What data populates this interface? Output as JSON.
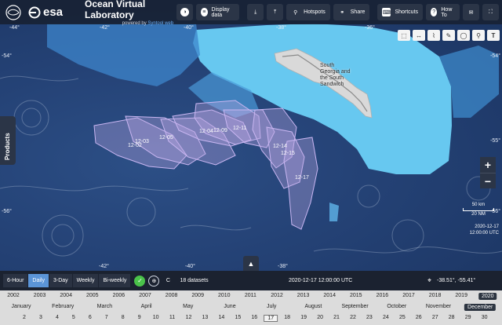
{
  "header": {
    "brand": "esa",
    "title": "Ocean Virtual Laboratory",
    "powered_prefix": "powered by",
    "powered_brand": "Syntool web",
    "buttons": [
      {
        "label": "",
        "icon": "palette-icon"
      },
      {
        "label": "Display data",
        "icon": "layers-icon"
      },
      {
        "label": "",
        "icon": "download-icon"
      },
      {
        "label": "",
        "icon": "upload-icon"
      },
      {
        "label": "Hotspots",
        "icon": "map-pin-icon"
      },
      {
        "label": "Share",
        "icon": "link-icon"
      },
      {
        "label": "Shortcuts",
        "icon": "keyboard-icon"
      },
      {
        "label": "How To",
        "icon": "help-icon"
      },
      {
        "label": "",
        "icon": "mail-icon"
      },
      {
        "label": "",
        "icon": "fullscreen-icon"
      }
    ]
  },
  "map": {
    "lat_labels": [
      "-54°",
      "-55°",
      "-56°"
    ],
    "lon_labels_top": [
      "-44°",
      "-42°",
      "-40°",
      "-38°",
      "-36°"
    ],
    "lon_labels_bottom": [
      "-42°",
      "-40°",
      "-38°"
    ],
    "island_label_lines": [
      "South",
      "Georgia and",
      "the South",
      "Sandwich"
    ],
    "track_labels": [
      "12-02",
      "12-03",
      "12-05",
      "12-04",
      "12-09",
      "12-11",
      "12-14",
      "12-15",
      "12-17"
    ],
    "scale_top": "50 km",
    "scale_bottom": "20 NM",
    "map_time_date": "2020-12-17",
    "map_time_clock": "12:00:00 UTC",
    "products_label": "Products",
    "zoom_in": "+",
    "zoom_out": "−",
    "expand_glyph": "▲",
    "toolbar_icons": [
      "rectangle-select-icon",
      "arrow-icon",
      "polyline-icon",
      "draw-icon",
      "circle-icon",
      "pin-icon",
      "text-icon"
    ]
  },
  "controls": {
    "steps": [
      "6-Hour",
      "Daily",
      "3-Day",
      "Weekly",
      "Bi-weekly"
    ],
    "active_step": "Daily",
    "datasets": "18 datasets",
    "current_datetime": "2020-12-17 12:00:00 UTC",
    "coordinates": "-38.51°, -55.41°",
    "colors": {
      "accent": "#5b95d8",
      "check": "#4ac24a"
    }
  },
  "timeline": {
    "years": [
      "2002",
      "2003",
      "2004",
      "2005",
      "2006",
      "2007",
      "2008",
      "2009",
      "2010",
      "2011",
      "2012",
      "2013",
      "2014",
      "2015",
      "2016",
      "2017",
      "2018",
      "2019",
      "2020"
    ],
    "selected_year": "2020",
    "months": [
      "January",
      "February",
      "March",
      "April",
      "May",
      "June",
      "July",
      "August",
      "September",
      "October",
      "November",
      "December"
    ],
    "selected_month": "December",
    "days": [
      "2",
      "3",
      "4",
      "5",
      "6",
      "7",
      "8",
      "9",
      "10",
      "11",
      "12",
      "13",
      "14",
      "15",
      "16",
      "17",
      "18",
      "19",
      "20",
      "21",
      "22",
      "23",
      "24",
      "25",
      "26",
      "27",
      "28",
      "29",
      "30"
    ],
    "selected_day": "17"
  }
}
